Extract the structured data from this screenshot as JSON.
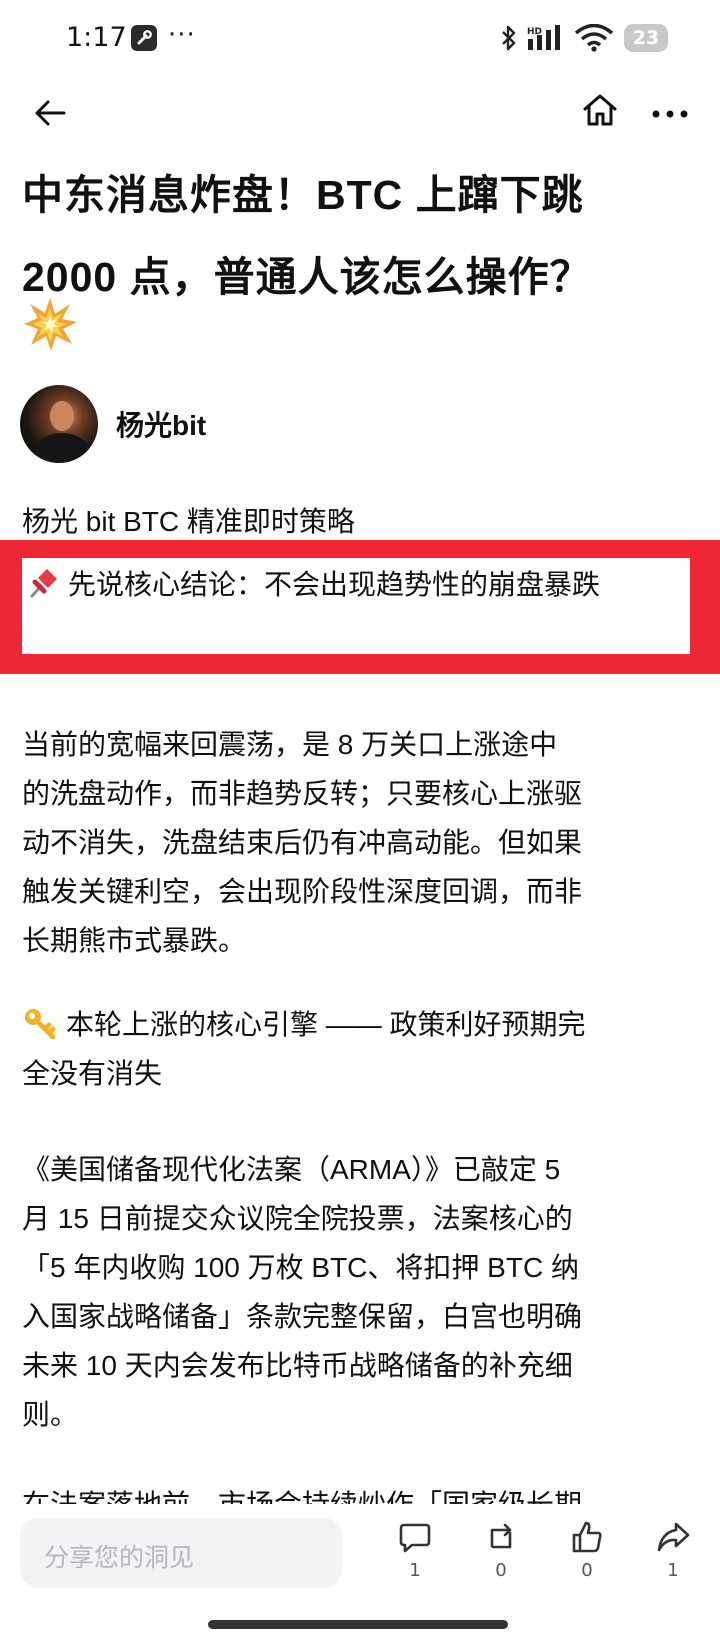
{
  "status_bar": {
    "time": "1:17",
    "dots": "···",
    "battery": "23",
    "icons": [
      "wrench-icon",
      "bluetooth-icon",
      "signal-icon",
      "wifi-icon",
      "battery-icon"
    ]
  },
  "nav": {
    "icons": [
      "back-arrow-icon",
      "home-icon",
      "more-icon"
    ]
  },
  "article": {
    "title_lines": [
      "中东消息炸盘！BTC 上蹿下跳",
      "2000 点，普通人该怎么操作？"
    ],
    "title_emoji": "collision-icon",
    "author": {
      "name": "杨光bit"
    },
    "subtitle": "杨光 bit BTC 精准即时策略",
    "highlight": {
      "icon": "pin-icon",
      "text": "先说核心结论：不会出现趋势性的崩盘暴跌",
      "border_color": "#ee2736"
    },
    "paragraph1_lines": [
      "当前的宽幅来回震荡，是 8 万关口上涨途中",
      "的洗盘动作，而非趋势反转；只要核心上涨驱",
      "动不消失，洗盘结束后仍有冲高动能。但如果",
      "触发关键利空，会出现阶段性深度回调，而非",
      "长期熊市式暴跌。"
    ],
    "section_heading": {
      "icon": "key-icon",
      "lines": [
        "本轮上涨的核心引擎 —— 政策利好预期完",
        "全没有消失"
      ]
    },
    "paragraph2_lines": [
      "《美国储备现代化法案（ARMA）》已敲定 5",
      "月 15 日前提交众议院全院投票，法案核心的",
      "「5 年内收购 100 万枚 BTC、将扣押 BTC 纳",
      "入国家战略储备」条款完整保留，白宫也明确",
      "未来 10 天内会发布比特币战略储备的补充细",
      "则。"
    ],
    "paragraph3_partial": "在法案落地前，市场会持续炒作「国家级长期"
  },
  "bottom_bar": {
    "comment_placeholder": "分享您的洞见",
    "actions": [
      {
        "icon": "comment-icon",
        "count": "1"
      },
      {
        "icon": "repost-icon",
        "count": "0"
      },
      {
        "icon": "like-icon",
        "count": "0"
      },
      {
        "icon": "share-icon",
        "count": "1"
      }
    ]
  }
}
